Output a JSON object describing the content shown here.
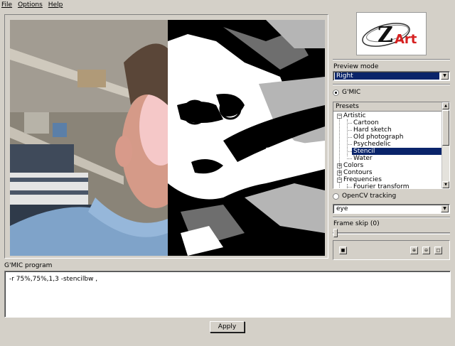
{
  "menu": [
    {
      "label": "File"
    },
    {
      "label": "Options"
    },
    {
      "label": "Help"
    }
  ],
  "logo": {
    "text": "Art",
    "letter": "Z"
  },
  "preview_mode": {
    "label": "Preview mode",
    "value": "Right"
  },
  "gmic_radio": {
    "label": "G'MIC",
    "checked": true
  },
  "presets": {
    "header": "Presets",
    "tree": {
      "artistic": "Artistic",
      "cartoon": "Cartoon",
      "hard_sketch": "Hard sketch",
      "old_photograph": "Old photograph",
      "psychedelic": "Psychedelic",
      "stencil": "Stencil",
      "water": "Water",
      "colors": "Colors",
      "contours": "Contours",
      "frequencies": "Frequencies",
      "fourier": "Fourier transform"
    },
    "selected": "Stencil"
  },
  "opencv_radio": {
    "label": "OpenCV tracking",
    "checked": false
  },
  "tracking_select": {
    "value": "eye"
  },
  "frame_skip": {
    "label": "Frame skip (0)",
    "value": 0
  },
  "program": {
    "label": "G'MIC program",
    "code": "-r 75%,75%,1,3 -stencilbw ,"
  },
  "apply_label": "Apply",
  "colors": {
    "selection": "#0a246a",
    "background": "#d4d0c8"
  }
}
